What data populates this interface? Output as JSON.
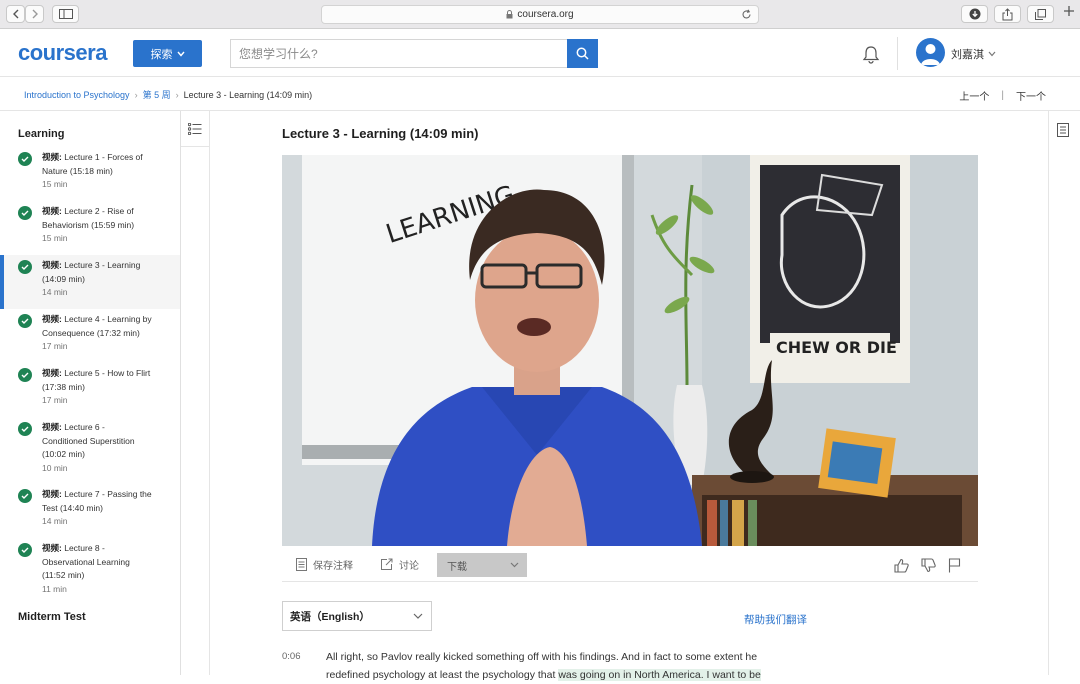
{
  "browser": {
    "url": "coursera.org"
  },
  "header": {
    "logo": "coursera",
    "explore_label": "探索",
    "search_placeholder": "您想学习什么?",
    "username": "刘嘉淇"
  },
  "breadcrumb": {
    "course": "Introduction to Psychology",
    "week": "第 5 周",
    "current": "Lecture 3 - Learning (14:09 min)",
    "prev_label": "上一个",
    "next_label": "下一个"
  },
  "sidebar": {
    "week_title": "Learning",
    "items": [
      {
        "kind": "视频:",
        "title": "Lecture 1 - Forces of Nature (15:18 min)",
        "duration": "15 min"
      },
      {
        "kind": "视频:",
        "title": "Lecture 2 - Rise of Behaviorism (15:59 min)",
        "duration": "15 min"
      },
      {
        "kind": "视频:",
        "title": "Lecture 3 - Learning (14:09 min)",
        "duration": "14 min"
      },
      {
        "kind": "视频:",
        "title": "Lecture 4 - Learning by Consequence (17:32 min)",
        "duration": "17 min"
      },
      {
        "kind": "视频:",
        "title": "Lecture 5 - How to Flirt (17:38 min)",
        "duration": "17 min"
      },
      {
        "kind": "视频:",
        "title": "Lecture 6 - Conditioned Superstition (10:02 min)",
        "duration": "10 min"
      },
      {
        "kind": "视频:",
        "title": "Lecture 7 - Passing the Test (14:40 min)",
        "duration": "14 min"
      },
      {
        "kind": "视频:",
        "title": "Lecture 8 - Observational Learning (11:52 min)",
        "duration": "11 min"
      }
    ],
    "next_section": "Midterm Test"
  },
  "main": {
    "lecture_title": "Lecture 3 - Learning (14:09 min)",
    "video": {
      "whiteboard_text": "LEARNING",
      "poster_text": "CHEW OR DIE"
    },
    "toolbar": {
      "save_notes": "保存注释",
      "discuss": "讨论",
      "download": "下载"
    },
    "transcript_language": "英语（English）",
    "help_translate": "帮助我们翻译",
    "transcript": {
      "timestamp": "0:06",
      "line1": "All right, so Pavlov really kicked something off with his findings. And in fact to some extent he",
      "line2_before": "redefined psychology at least the psychology that ",
      "line2_highlight": "was going on in North America. I want to be"
    }
  },
  "colors": {
    "brand": "#2a73cc",
    "complete": "#1f8354"
  }
}
